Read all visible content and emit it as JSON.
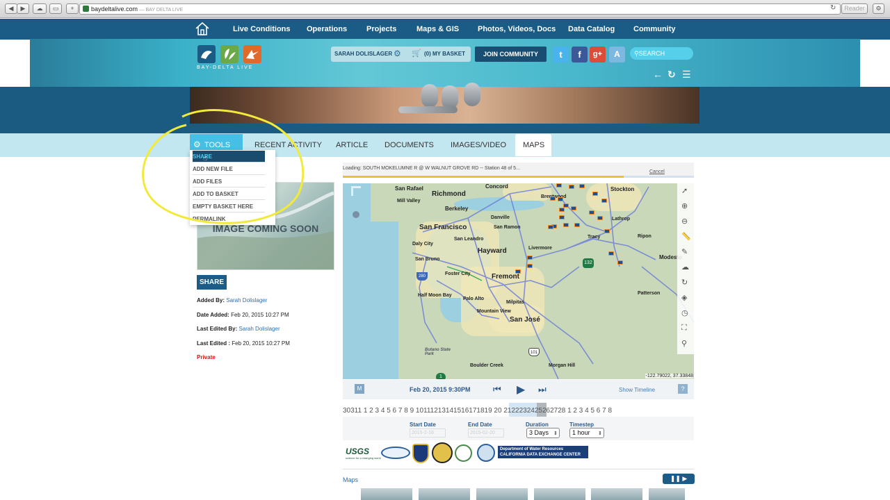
{
  "browser": {
    "url": "baydeltalive.com",
    "title": "— BAY DELTA LIVE",
    "reader": "Reader"
  },
  "nav": {
    "items": [
      "Live Conditions",
      "Operations",
      "Projects",
      "Maps & GIS",
      "Photos, Videos, Docs",
      "Data Catalog",
      "Community"
    ]
  },
  "header": {
    "logo_text": "BAY-DELTA LIVE",
    "user": "SARAH DOLISLAGER",
    "basket": "(0) MY BASKET",
    "join": "JOIN COMMUNITY",
    "search": "SEARCH"
  },
  "tabs": {
    "tools": "TOOLS",
    "items": [
      "RECENT ACTIVITY",
      "ARTICLE",
      "DOCUMENTS",
      "IMAGES/VIDEO",
      "MAPS"
    ]
  },
  "tools_menu": {
    "items": [
      "SHARE",
      "ADD NEW FILE",
      "ADD FILES",
      "ADD TO BASKET",
      "EMPTY BASKET HERE",
      "PERMALINK"
    ]
  },
  "preview": {
    "text": "IMAGE COMING SOON"
  },
  "details": {
    "share": "SHARE",
    "added_by_label": "Added By:",
    "added_by": "Sarah Dolislager",
    "date_added_label": "Date Added:",
    "date_added": "Feb 20, 2015 10:27 PM",
    "last_edited_by_label": "Last Edited By:",
    "last_edited_by": "Sarah Dolislager",
    "last_edited_label": "Last Edited :",
    "last_edited": "Feb 20, 2015 10:27 PM",
    "privacy": "Private"
  },
  "map": {
    "loading": "Loading: SOUTH MOKELUMNE R @ W WALNUT GROVE RD -- Station 48 of 5...",
    "cancel": "Cancel",
    "coords": "-122.79022, 37.33848",
    "places": [
      "San Rafael",
      "Concord",
      "Stockton",
      "Mill Valley",
      "Richmond",
      "Berkeley",
      "Brentwood",
      "Danville",
      "San Francisco",
      "San Ramon",
      "Lathrop",
      "Daly City",
      "San Leandro",
      "Tracy",
      "Ripon",
      "Hayward",
      "Livermore",
      "Modesto",
      "San Bruno",
      "Foster City",
      "Fremont",
      "Half Moon Bay",
      "Palo Alto",
      "Milpitas",
      "Patterson",
      "Mountain View",
      "San José",
      "Butano State Park",
      "Boulder Creek",
      "Morgan Hill"
    ],
    "shields": [
      "280",
      "132",
      "101",
      "1"
    ]
  },
  "timeline": {
    "m": "M",
    "date": "Feb 20, 2015 9:30PM",
    "show": "Show Timeline",
    "help": "?",
    "days": "30311 1  2  3  4  5  6  7  8  9  10111213141516171819 20 2122232425262728 1  2  3  4  5  6  7  8",
    "start_label": "Start Date",
    "start_value": "2015-2-18",
    "end_label": "End Date",
    "end_value": "2015-02-20",
    "duration_label": "Duration",
    "duration_value": "3 Days",
    "timestep_label": "Timestep",
    "timestep_value": "1 hour"
  },
  "partners": {
    "usgs": "USGS",
    "usgs_tag": "science for a changing world",
    "dwr_line1": "Department of Water Resources",
    "dwr_line2": "CALIFORNIA DATA EXCHANGE CENTER"
  },
  "maps_section": {
    "label": "Maps"
  }
}
